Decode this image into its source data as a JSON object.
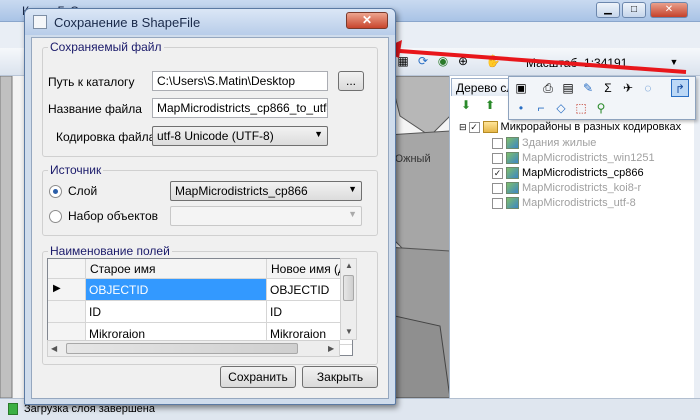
{
  "main": {
    "window_title": "Карта ГиС",
    "scale_label": "Масштаб",
    "scale_value": "1:34191",
    "map_labels": [
      "Южный"
    ],
    "tree_tab": "Дерево сл",
    "tree": {
      "root": "Микрорайоны в разных кодировках",
      "items": [
        {
          "label": "Здания жилые",
          "checked": false,
          "disabled": true
        },
        {
          "label": "MapMicrodistricts_win1251",
          "checked": false,
          "disabled": true
        },
        {
          "label": "MapMicrodistricts_cp866",
          "checked": true,
          "disabled": false
        },
        {
          "label": "MapMicrodistricts_koi8-r",
          "checked": false,
          "disabled": true
        },
        {
          "label": "MapMicrodistricts_utf-8",
          "checked": false,
          "disabled": true
        }
      ]
    },
    "status_text": "Загрузка слоя завершена"
  },
  "dialog": {
    "title": "Сохранение в ShapeFile",
    "close_glyph": "✕",
    "file_group": {
      "title": "Сохраняемый файл",
      "path_label": "Путь к каталогу",
      "path_value": "C:\\Users\\S.Matin\\Desktop",
      "browse_label": "...",
      "name_label": "Название файла",
      "name_value": "MapMicrodistricts_cp866_to_utf8",
      "encoding_label": "Кодировка файла",
      "encoding_value": "utf-8 Unicode (UTF-8)"
    },
    "source_group": {
      "title": "Источник",
      "layer_label": "Слой",
      "layer_value": "MapMicrodistricts_cp866",
      "objects_label": "Набор объектов",
      "objects_value": ""
    },
    "fields_group": {
      "title": "Наименование полей",
      "columns": [
        "Старое имя",
        "Новое имя (дл"
      ],
      "rows": [
        {
          "old": "OBJECTID",
          "new": "OBJECTID",
          "selected": true
        },
        {
          "old": "ID",
          "new": "ID",
          "selected": false
        },
        {
          "old": "Mikroraion",
          "new": "Mikroraion",
          "selected": false
        }
      ]
    },
    "save_label": "Сохранить",
    "close_label": "Закрыть"
  },
  "colors": {
    "accent": "#3399ff",
    "arrow": "#e8161b",
    "map_region": "#9a9a9a"
  }
}
